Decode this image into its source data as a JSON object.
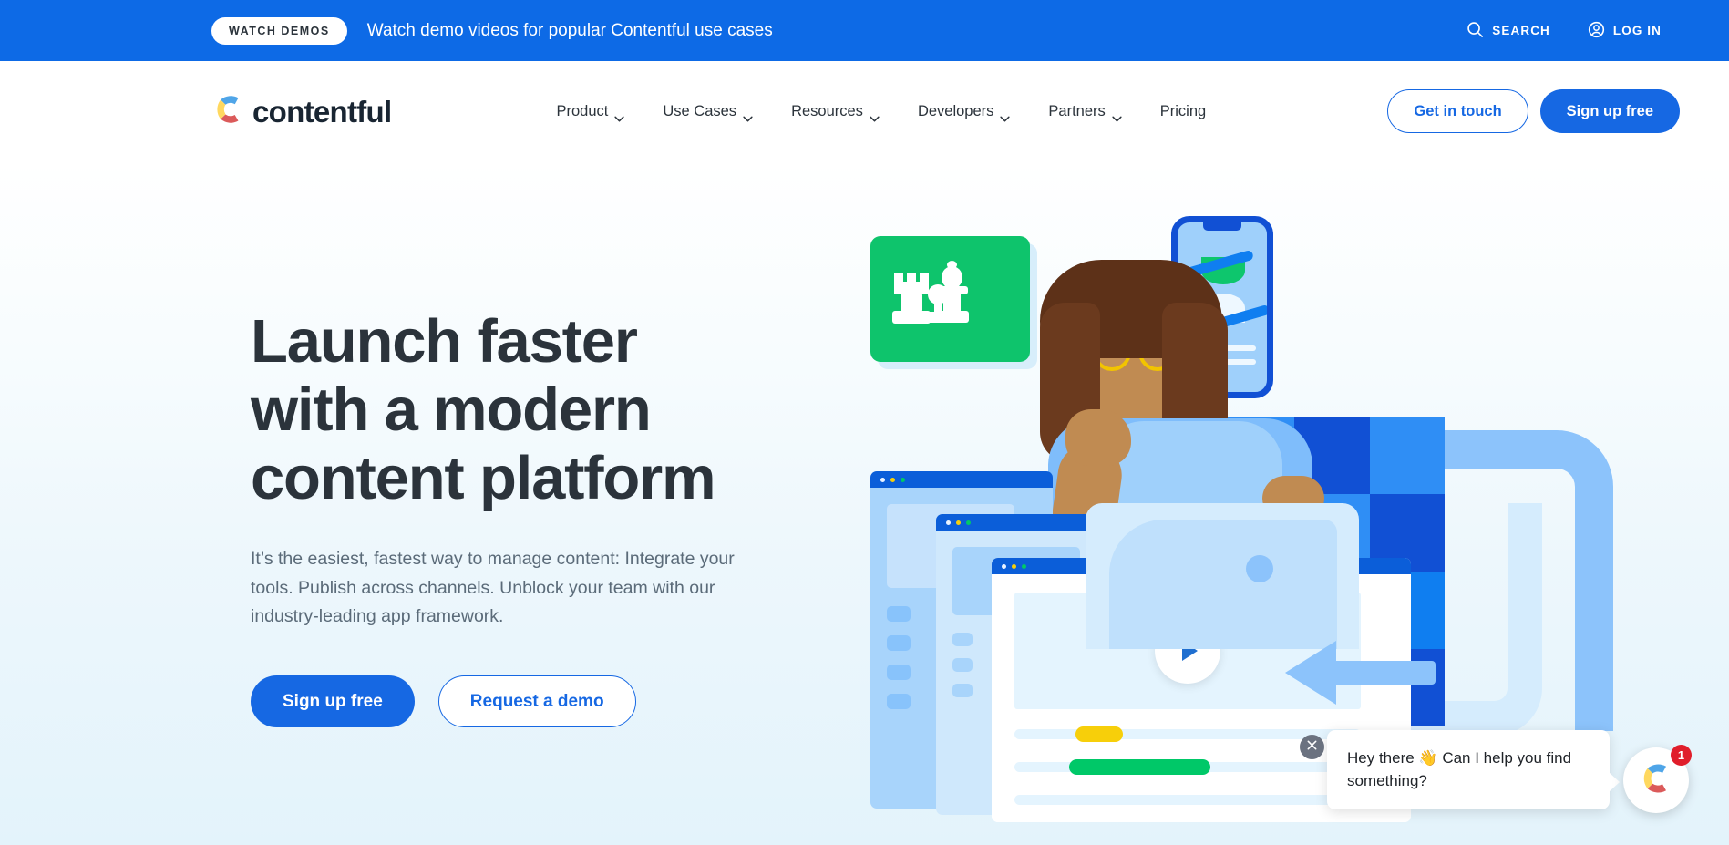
{
  "banner": {
    "pill_label": "WATCH DEMOS",
    "message": "Watch demo videos for popular Contentful use cases",
    "search_label": "SEARCH",
    "login_label": "LOG IN",
    "bg_color": "#0d6ae6"
  },
  "header": {
    "logo_text": "contentful",
    "nav": [
      {
        "label": "Product",
        "has_chevron": true
      },
      {
        "label": "Use Cases",
        "has_chevron": true
      },
      {
        "label": "Resources",
        "has_chevron": true
      },
      {
        "label": "Developers",
        "has_chevron": true
      },
      {
        "label": "Partners",
        "has_chevron": true
      },
      {
        "label": "Pricing",
        "has_chevron": false
      }
    ],
    "cta_secondary": "Get in touch",
    "cta_primary": "Sign up free"
  },
  "hero": {
    "title_line1": "Launch faster",
    "title_line2": "with a modern",
    "title_line3": "content platform",
    "subtitle": "It’s the easiest, fastest way to manage content: Integrate your tools. Publish across channels. Unblock your team with our industry-leading app framework.",
    "cta_primary": "Sign up free",
    "cta_secondary": "Request a demo",
    "accent_blue": "#1668e3",
    "heading_color": "#2b333b",
    "body_color": "#5b6b79"
  },
  "chat": {
    "message": "Hey there 👋 Can I help you find something?",
    "badge_count": "1",
    "close_icon": "close-icon",
    "avatar_icon": "contentful-logo-icon",
    "badge_color": "#e01e2b"
  },
  "illustration": {
    "green_card_color": "#0ec46c",
    "checker_dark": "#1150d4",
    "checker_mid": "#0f7ef0",
    "checker_light": "#2f8ef5",
    "pipe_color": "#8cc3fb",
    "highlight_yellow": "#f7cf0a",
    "highlight_green": "#00c868"
  }
}
